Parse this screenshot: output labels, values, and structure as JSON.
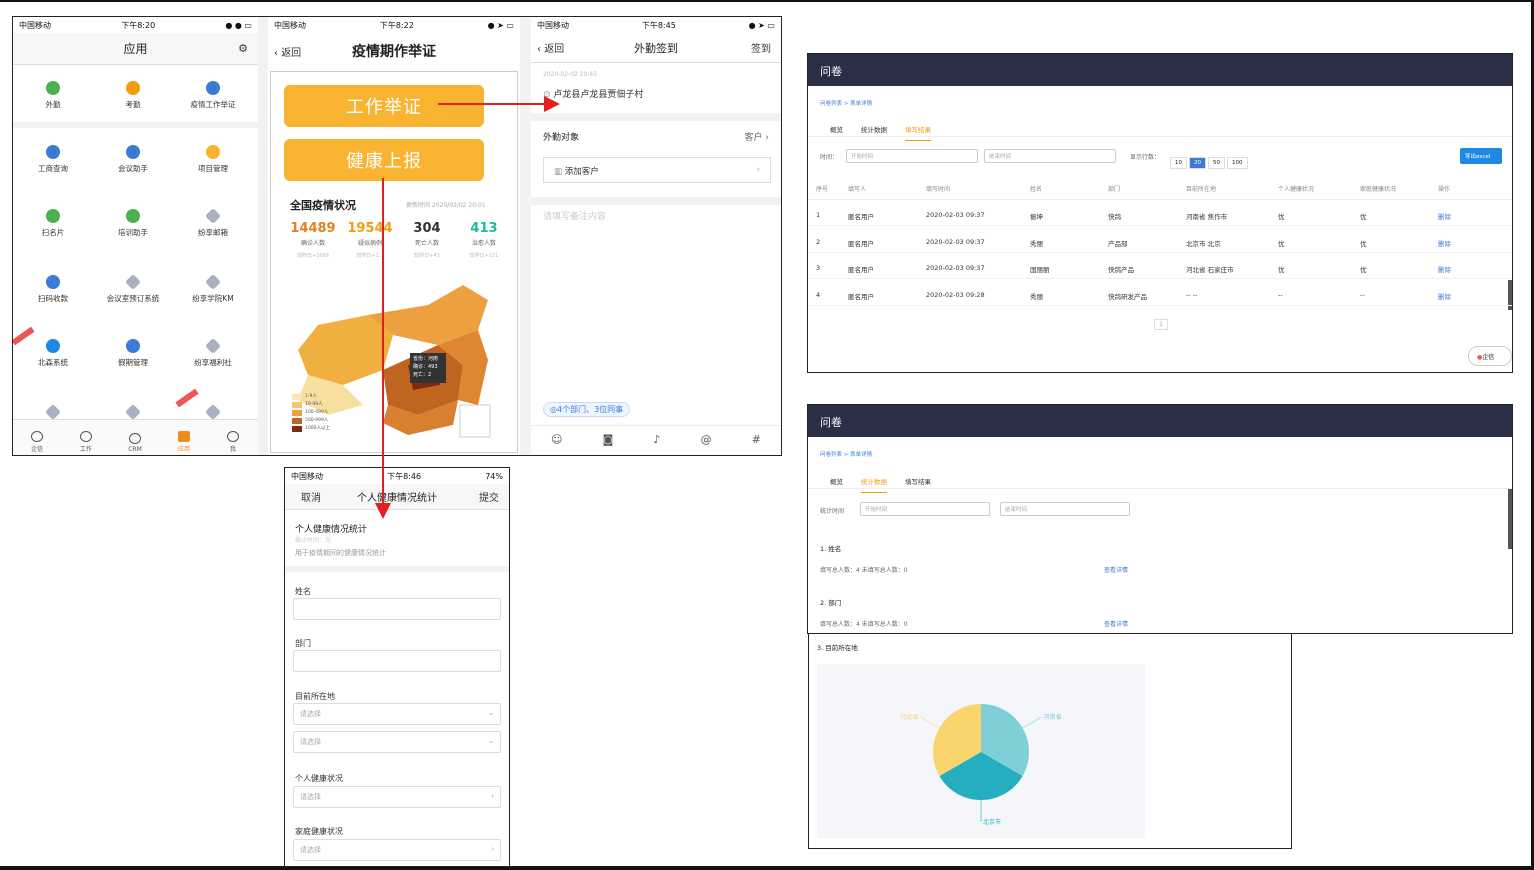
{
  "panel1": {
    "status": {
      "carrier": "中国移动",
      "time": "下午8:20"
    },
    "title": "应用",
    "grid": [
      {
        "label": "外勤",
        "icon": "location-icon",
        "color": "#4caf50"
      },
      {
        "label": "考勤",
        "icon": "check-pin-icon",
        "color": "#f39c12"
      },
      {
        "label": "疫情工作举证",
        "icon": "document-icon",
        "color": "#3a7bd5"
      },
      {
        "label": "工商查询",
        "icon": "building-icon",
        "color": "#3a7bd5"
      },
      {
        "label": "会议助手",
        "icon": "meeting-icon",
        "color": "#3a7bd5"
      },
      {
        "label": "项目管理",
        "icon": "project-icon",
        "color": "#f8b330"
      },
      {
        "label": "扫名片",
        "icon": "card-scan-icon",
        "color": "#4caf50"
      },
      {
        "label": "培训助手",
        "icon": "book-icon",
        "color": "#4caf50"
      },
      {
        "label": "纷享邮箱",
        "icon": "cube-icon",
        "color": "#aab0c0"
      },
      {
        "label": "扫码收款",
        "icon": "qr-icon",
        "color": "#3a7bd5"
      },
      {
        "label": "会议室预订系统",
        "icon": "cube-icon",
        "color": "#aab0c0"
      },
      {
        "label": "纷享学院KM",
        "icon": "cube-icon",
        "color": "#aab0c0"
      },
      {
        "label": "北森系统",
        "icon": "info-icon",
        "color": "#1e88e5"
      },
      {
        "label": "假期管理",
        "icon": "calendar-icon",
        "color": "#3a7bd5"
      },
      {
        "label": "纷享福利社",
        "icon": "cube-icon",
        "color": "#aab0c0"
      }
    ],
    "tabs": [
      "企信",
      "工作",
      "CRM",
      "应用",
      "我"
    ]
  },
  "panel2": {
    "status": {
      "carrier": "中国移动",
      "time": "下午8:22"
    },
    "back": "返回",
    "title": "疫情期作举证",
    "btn1": "工作举证",
    "btn2": "健康上报",
    "section": "全国疫情状况",
    "updated": "更新时间 2020/02/02 20:01",
    "stats": [
      {
        "n": "14489",
        "label": "确诊人数",
        "delta": "较昨日+2668",
        "color": "#e67e22"
      },
      {
        "n": "19544",
        "label": "疑似病例",
        "delta": "较昨日+1...",
        "color": "#f39c12"
      },
      {
        "n": "304",
        "label": "死亡人数",
        "delta": "较昨日+45",
        "color": "#333"
      },
      {
        "n": "413",
        "label": "治愈人数",
        "delta": "较昨日+171",
        "color": "#1abc9c"
      }
    ],
    "tooltip": [
      "省份：河南",
      "确诊：493",
      "死亡：2"
    ],
    "legend": [
      "1-9人",
      "10-99人",
      "100-499人",
      "500-999人",
      "1000人以上"
    ]
  },
  "panel3": {
    "status": {
      "carrier": "中国移动",
      "time": "下午8:45"
    },
    "back": "返回",
    "title": "外勤签到",
    "action": "签到",
    "timestamp": "2020-02-02 20:45",
    "address": "卢龙县卢龙县贾佃子村",
    "target_label": "外勤对象",
    "target_value": "客户",
    "add_customer": "添加客户",
    "note_placeholder": "请填写备注内容",
    "visibility": "4个部门、3位同事"
  },
  "panel4": {
    "status": {
      "carrier": "中国移动",
      "time": "下午8:46",
      "battery": "74%"
    },
    "cancel": "取消",
    "title": "个人健康情况统计",
    "submit": "提交",
    "form_title": "个人健康情况统计",
    "deadline": "截止时间：无",
    "desc": "用于疫情期间的健康情况统计",
    "fields": [
      {
        "label": "姓名",
        "placeholder": ""
      },
      {
        "label": "部门",
        "placeholder": ""
      },
      {
        "label": "目前所在地",
        "placeholder": "请选择"
      },
      {
        "label": "",
        "placeholder": "请选择"
      },
      {
        "label": "个人健康状况",
        "placeholder": "请选择"
      },
      {
        "label": "家庭健康状况",
        "placeholder": "请选择"
      }
    ]
  },
  "panel5": {
    "header": "问卷",
    "breadcrumb": "问卷列表 > 表单详情",
    "tabs": [
      "概览",
      "统计数据",
      "填写结果"
    ],
    "time_label": "时间：",
    "start_ph": "开始时间",
    "end_ph": "结束时间",
    "rows_label": "显示行数：",
    "page_sizes": [
      "10",
      "20",
      "50",
      "100"
    ],
    "export": "导出excel",
    "columns": [
      "序号",
      "填写人",
      "填写时间",
      "姓名",
      "部门",
      "目前所在地",
      "个人健康状况",
      "家庭健康状况",
      "操作"
    ],
    "rows": [
      [
        "1",
        "匿名用户",
        "2020-02-03 09:37",
        "振坤",
        "快鸽",
        "河南省 焦作市",
        "优",
        "优",
        "删除"
      ],
      [
        "2",
        "匿名用户",
        "2020-02-03 09:37",
        "秀丽",
        "产品部",
        "北京市 北京",
        "优",
        "优",
        "删除"
      ],
      [
        "3",
        "匿名用户",
        "2020-02-03 09:37",
        "国丽丽",
        "快鸽产品",
        "河北省 石家庄市",
        "优",
        "优",
        "删除"
      ],
      [
        "4",
        "匿名用户",
        "2020-02-03 09:28",
        "秀丽",
        "快鸽研发产品",
        "-- --",
        "--",
        "--",
        "删除"
      ]
    ],
    "page": "1",
    "chat_btn": "企信"
  },
  "panel6": {
    "header": "问卷",
    "breadcrumb": "问卷列表 > 表单详情",
    "tabs": [
      "概览",
      "统计数据",
      "填写结果"
    ],
    "time_label": "统计时间",
    "start_ph": "开始时间",
    "end_ph": "结束时间",
    "q1": "1. 姓名",
    "q1_stats": "填写总人数：4   未填写总人数：0",
    "q2": "2. 部门",
    "q2_stats": "填写总人数：4   未填写总人数：0",
    "detail": "查看详情"
  },
  "panel7": {
    "q3": "3. 目前所在地",
    "chart_data": {
      "type": "pie",
      "categories": [
        "河北省",
        "河南省",
        "北京市"
      ],
      "values": [
        1,
        1,
        1
      ],
      "colors": [
        "#f9d56e",
        "#7ecfd8",
        "#24aec0"
      ]
    }
  },
  "arrow_color": "#e02020"
}
